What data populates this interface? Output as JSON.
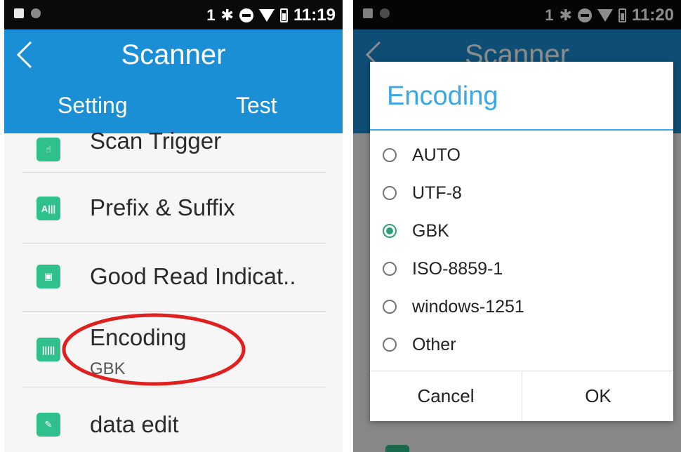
{
  "left_screen": {
    "status": {
      "sim": "1",
      "time": "11:19"
    },
    "appbar": {
      "title": "Scanner"
    },
    "tabs": [
      "Setting",
      "Test"
    ],
    "items": [
      {
        "label": "Scan Trigger",
        "icon": "trigger-icon"
      },
      {
        "label": "Prefix & Suffix",
        "icon": "prefix-suffix-icon"
      },
      {
        "label": "Good Read Indicat..",
        "icon": "good-read-icon"
      },
      {
        "label": "Encoding",
        "summary": "GBK",
        "icon": "barcode-icon"
      },
      {
        "label": "data edit",
        "icon": "edit-icon"
      }
    ],
    "highlight": {
      "shape": "red ellipse",
      "target": "Encoding"
    }
  },
  "right_screen": {
    "status": {
      "sim": "1",
      "time": "11:20"
    },
    "appbar": {
      "title": "Scanner"
    },
    "dialog": {
      "title": "Encoding",
      "options": [
        "AUTO",
        "UTF-8",
        "GBK",
        "ISO-8859-1",
        "windows-1251",
        "Other"
      ],
      "selected": "GBK",
      "cancel_label": "Cancel",
      "ok_label": "OK"
    }
  },
  "colors": {
    "primary": "#1b8fd6",
    "accent": "#3aa8e6",
    "icon_green": "#2fc08b",
    "highlight": "#e0201e"
  }
}
